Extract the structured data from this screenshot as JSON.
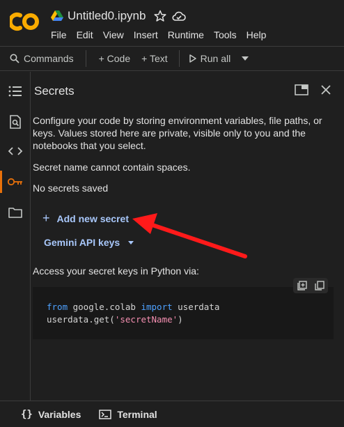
{
  "header": {
    "title": "Untitled0.ipynb",
    "menu": [
      "File",
      "Edit",
      "View",
      "Insert",
      "Runtime",
      "Tools",
      "Help"
    ]
  },
  "toolbar": {
    "commands": "Commands",
    "code": "+ Code",
    "text": "+ Text",
    "run_all": "Run all"
  },
  "rail": {
    "icons": [
      "toc-icon",
      "find-icon",
      "code-snippets-icon",
      "key-icon",
      "folder-icon"
    ],
    "active": "key-icon"
  },
  "panel": {
    "title": "Secrets",
    "description": "Configure your code by storing environment variables, file paths, or keys. Values stored here are private, visible only to you and the notebooks that you select.",
    "note_spaces": "Secret name cannot contain spaces.",
    "note_empty": "No secrets saved",
    "add_secret": "Add new secret",
    "gemini_keys": "Gemini API keys",
    "access_text": "Access your secret keys in Python via:",
    "code": {
      "kw_from": "from",
      "module": " google.colab ",
      "kw_import": "import",
      "name": " userdata",
      "line2_prefix": "userdata.get(",
      "line2_string": "'secretName'",
      "line2_suffix": ")"
    }
  },
  "bottom": {
    "variables": "Variables",
    "terminal": "Terminal"
  },
  "colors": {
    "background": "#1f1f1f",
    "accent": "#e8710a",
    "link": "#a8c7fa",
    "annotation_arrow": "#ff1a1a"
  }
}
